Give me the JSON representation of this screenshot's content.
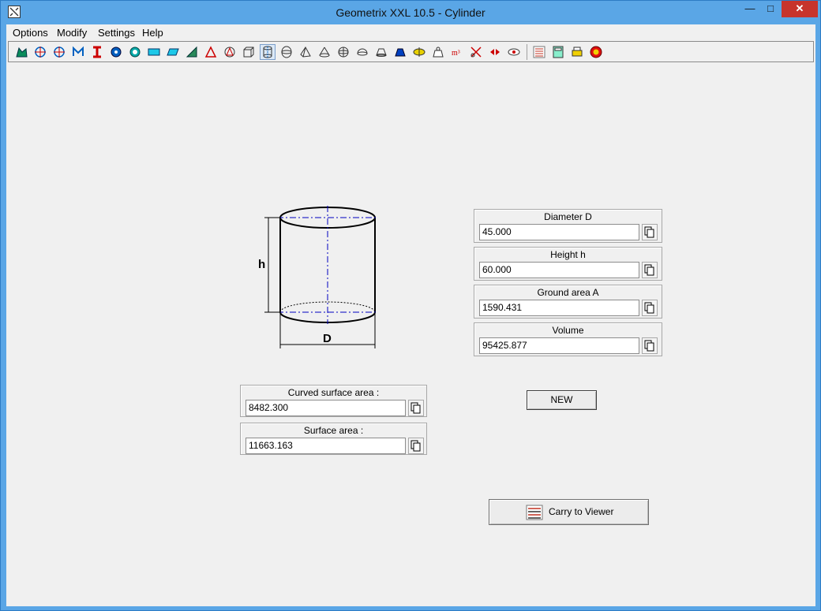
{
  "window": {
    "title": "Geometrix XXL 10.5 - Cylinder",
    "controls": {
      "minimize": "—",
      "maximize": "□",
      "close": "✕"
    }
  },
  "menu": [
    "Options",
    "Modify",
    "Settings",
    "Help"
  ],
  "toolbar": {
    "icons": [
      "shape-icon",
      "circle-cross-icon",
      "circle-cross-icon",
      "m-profile-icon",
      "i-beam-icon",
      "circle-dots-icon",
      "circle-ring-icon",
      "rectangle-icon",
      "parallelogram-icon",
      "right-triangle-icon",
      "triangle-icon",
      "triangle-circle-icon",
      "cube-icon",
      "cylinder-icon",
      "sphere-barrel-icon",
      "pyramid-icon",
      "cone-icon",
      "sphere-icon",
      "hemisphere-icon",
      "frustum-icon",
      "prism-icon",
      "lens-icon",
      "weight-icon",
      "formula-icon",
      "tools-icon",
      "arrow-icon",
      "ellipse-icon",
      "list-icon",
      "calculator-icon",
      "printer-icon",
      "stop-icon"
    ],
    "active_index": 13
  },
  "diagram": {
    "height_label": "h",
    "diameter_label": "D"
  },
  "fields": [
    {
      "label": "Diameter D",
      "value": "45.000"
    },
    {
      "label": "Height h",
      "value": "60.000"
    },
    {
      "label": "Ground area A",
      "value": "1590.431"
    },
    {
      "label": "Volume",
      "value": "95425.877"
    }
  ],
  "results": [
    {
      "label": "Curved surface area :",
      "value": "8482.300"
    },
    {
      "label": "Surface area :",
      "value": "11663.163"
    }
  ],
  "buttons": {
    "new_label": "NEW",
    "carry_label": "Carry to Viewer"
  },
  "colors": {
    "titlebar": "#5aa6e6",
    "close": "#c7342c",
    "axis": "#0000c0",
    "toolbar_icon": "#0060c0"
  }
}
